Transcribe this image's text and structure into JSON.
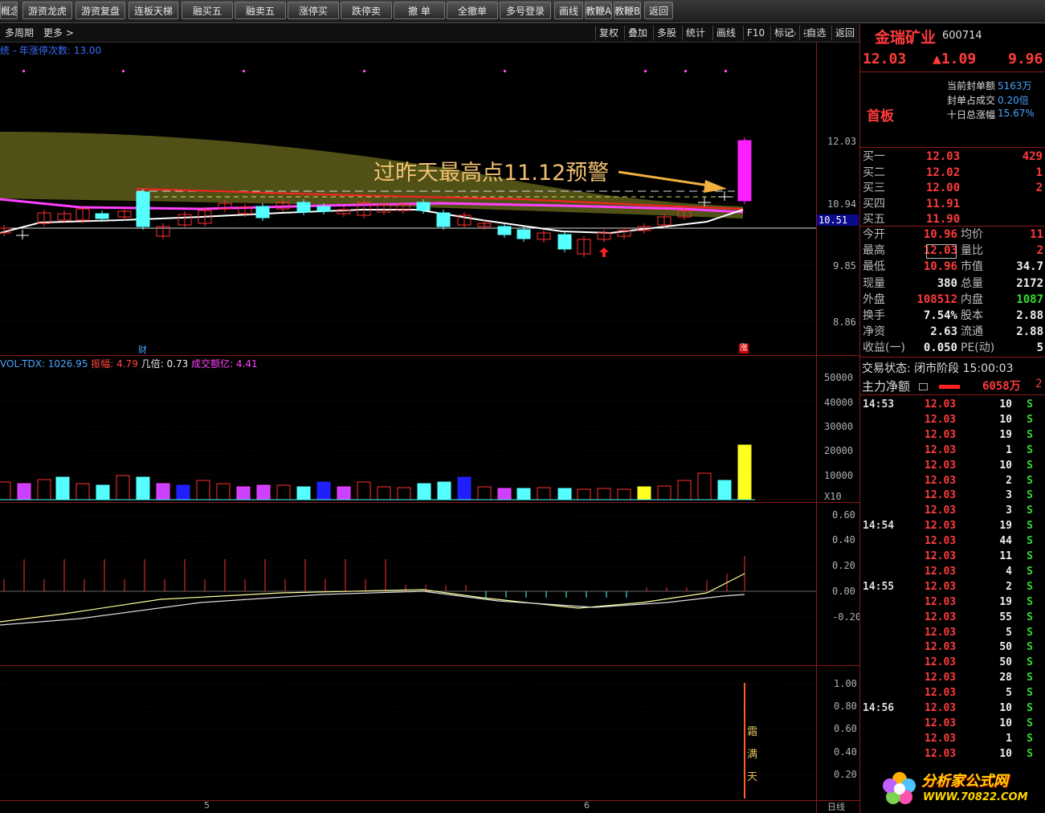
{
  "toolbar": {
    "buttons": [
      "概念",
      "游资龙虎",
      "游资复盘",
      "连板天梯",
      "融买五",
      "融卖五",
      "涨停买",
      "跌停卖",
      "撤 单",
      "全撤单",
      "多号登录",
      "画线",
      "教鞭A",
      "教鞭B",
      "返回"
    ]
  },
  "subbar": {
    "left": [
      "多周期",
      "更多 >"
    ],
    "right": [
      "复权",
      "叠加",
      "多股",
      "统计",
      "画线",
      "F10",
      "标记",
      "-自选",
      "返回"
    ]
  },
  "main_chart": {
    "indicator_label": "统 - 年涨停次数: 13.00",
    "annotation": "过昨天最高点11.12预警",
    "price_axis": [
      "12.03",
      "10.94",
      "9.85",
      "8.86"
    ],
    "current_price_tag": "10.51",
    "markers": [
      "财",
      "涨"
    ]
  },
  "volume_panel": {
    "legend": [
      {
        "text": "VOL-TDX: 1026.95",
        "color": "#4aa3ff"
      },
      {
        "text": "振幅: 4.79",
        "color": "#ff4444"
      },
      {
        "text": "几倍: 0.73",
        "color": "#eeeeee"
      },
      {
        "text": "成交额亿: 4.41",
        "color": "#ff44ff"
      }
    ],
    "axis": [
      "50000",
      "40000",
      "30000",
      "20000",
      "10000",
      "X10"
    ]
  },
  "macd_panel": {
    "axis": [
      "0.60",
      "0.40",
      "0.20",
      "0.00",
      "-0.20"
    ]
  },
  "bottom_panel": {
    "axis": [
      "1.00",
      "0.80",
      "0.60",
      "0.40",
      "0.20"
    ],
    "vertical_text": [
      "霜",
      "满",
      "天"
    ],
    "date_labels": [
      "5",
      "6"
    ],
    "period": "日线"
  },
  "stock": {
    "name": "金瑞矿业",
    "code": "600714",
    "price": "12.03",
    "change": "▲1.09",
    "pct": "9.96",
    "board": "首板",
    "seal_info": [
      {
        "label": "当前封单额",
        "value": "5163万"
      },
      {
        "label": "封单占成交",
        "value": "0.20倍"
      },
      {
        "label": "十日总涨幅",
        "value": "15.67%"
      }
    ],
    "bids": [
      {
        "label": "买一",
        "price": "12.03",
        "vol": "429"
      },
      {
        "label": "买二",
        "price": "12.02",
        "vol": "1"
      },
      {
        "label": "买三",
        "price": "12.00",
        "vol": "2"
      },
      {
        "label": "买四",
        "price": "11.91",
        "vol": ""
      },
      {
        "label": "买五",
        "price": "11.90",
        "vol": ""
      }
    ],
    "stats": [
      {
        "l1": "今开",
        "v1": "10.96",
        "l2": "均价",
        "v2": "11",
        "c1": "red",
        "c2": "red"
      },
      {
        "l1": "最高",
        "v1": "12.03",
        "l2": "量比",
        "v2": "2",
        "c1": "red",
        "c2": "red"
      },
      {
        "l1": "最低",
        "v1": "10.96",
        "l2": "市值",
        "v2": "34.7",
        "c1": "red",
        "c2": "white"
      },
      {
        "l1": "现量",
        "v1": "380",
        "l2": "总量",
        "v2": "2172",
        "c1": "white",
        "c2": "white"
      },
      {
        "l1": "外盘",
        "v1": "108512",
        "l2": "内盘",
        "v2": "1087",
        "c1": "red",
        "c2": "green"
      },
      {
        "l1": "换手",
        "v1": "7.54%",
        "l2": "股本",
        "v2": "2.88",
        "c1": "white",
        "c2": "white"
      },
      {
        "l1": "净资",
        "v1": "2.63",
        "l2": "流通",
        "v2": "2.88",
        "c1": "white",
        "c2": "white"
      },
      {
        "l1": "收益(一)",
        "v1": "0.050",
        "l2": "PE(动)",
        "v2": "5",
        "c1": "white",
        "c2": "white"
      }
    ],
    "trade_status": "交易状态: 闭市阶段 15:00:03",
    "main_net_label": "主力净额",
    "main_net_value": "6058万",
    "main_net_extra": "2"
  },
  "ticks": [
    {
      "time": "14:53",
      "price": "12.03",
      "vol": "10",
      "side": "S"
    },
    {
      "time": "",
      "price": "12.03",
      "vol": "10",
      "side": "S"
    },
    {
      "time": "",
      "price": "12.03",
      "vol": "19",
      "side": "S"
    },
    {
      "time": "",
      "price": "12.03",
      "vol": "1",
      "side": "S"
    },
    {
      "time": "",
      "price": "12.03",
      "vol": "10",
      "side": "S"
    },
    {
      "time": "",
      "price": "12.03",
      "vol": "2",
      "side": "S"
    },
    {
      "time": "",
      "price": "12.03",
      "vol": "3",
      "side": "S"
    },
    {
      "time": "",
      "price": "12.03",
      "vol": "3",
      "side": "S"
    },
    {
      "time": "14:54",
      "price": "12.03",
      "vol": "19",
      "side": "S"
    },
    {
      "time": "",
      "price": "12.03",
      "vol": "44",
      "side": "S"
    },
    {
      "time": "",
      "price": "12.03",
      "vol": "11",
      "side": "S"
    },
    {
      "time": "",
      "price": "12.03",
      "vol": "4",
      "side": "S"
    },
    {
      "time": "14:55",
      "price": "12.03",
      "vol": "2",
      "side": "S"
    },
    {
      "time": "",
      "price": "12.03",
      "vol": "19",
      "side": "S"
    },
    {
      "time": "",
      "price": "12.03",
      "vol": "55",
      "side": "S"
    },
    {
      "time": "",
      "price": "12.03",
      "vol": "5",
      "side": "S"
    },
    {
      "time": "",
      "price": "12.03",
      "vol": "50",
      "side": "S"
    },
    {
      "time": "",
      "price": "12.03",
      "vol": "50",
      "side": "S"
    },
    {
      "time": "",
      "price": "12.03",
      "vol": "28",
      "side": "S"
    },
    {
      "time": "",
      "price": "12.03",
      "vol": "5",
      "side": "S"
    },
    {
      "time": "14:56",
      "price": "12.03",
      "vol": "10",
      "side": "S"
    },
    {
      "time": "",
      "price": "12.03",
      "vol": "10",
      "side": "S"
    },
    {
      "time": "",
      "price": "12.03",
      "vol": "1",
      "side": "S"
    },
    {
      "time": "",
      "price": "12.03",
      "vol": "10",
      "side": "S"
    }
  ],
  "watermark": {
    "line1": "分析家公式网",
    "line2": "WWW.70822.COM"
  }
}
